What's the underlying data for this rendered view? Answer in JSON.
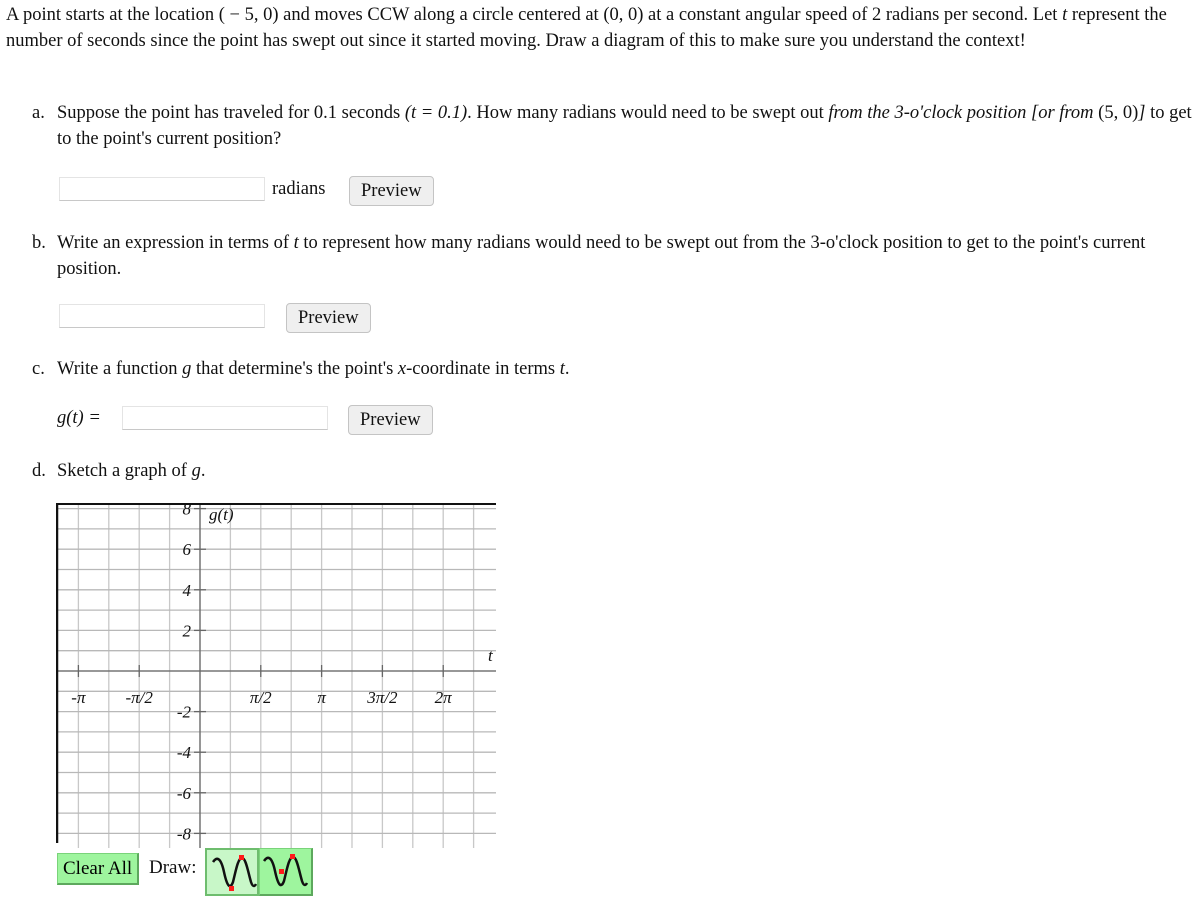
{
  "intro": {
    "p1": "A point starts at the location ",
    "start_point": "( − 5, 0)",
    "p2": " and moves CCW along a circle centered at ",
    "center": "(0, 0)",
    "p3": " at a constant angular speed of 2 radians per second. Let ",
    "var_t": "t",
    "p4": " represent the number of seconds since the point has swept out since it started moving. Draw a diagram of this to make sure you understand the context!"
  },
  "part_a": {
    "label": "a.",
    "text1": "Suppose the point has traveled for 0.1 seconds ",
    "math1": "(t = 0.1)",
    "text2": ". How many radians would need to be swept out ",
    "italic": "from the 3-o'clock position [or from ",
    "math2": "(5, 0)",
    "italic2": "]",
    "text3": " to get to the point's current position?",
    "input_value": "",
    "unit": "radians",
    "preview_label": "Preview"
  },
  "part_b": {
    "label": "b.",
    "text1": "Write an expression in terms of ",
    "var": "t",
    "text2": " to represent how many radians would need to be swept out from the 3-o'clock position to get to the point's current position.",
    "input_value": "",
    "preview_label": "Preview"
  },
  "part_c": {
    "label": "c.",
    "text1": "Write a function ",
    "var_g": "g",
    "text2": " that determine's the point's ",
    "var_x": "x",
    "text3": "-coordinate in terms ",
    "var_t": "t",
    "text4": ".",
    "func_label": "g(t) =",
    "input_value": "",
    "preview_label": "Preview"
  },
  "part_d": {
    "label": "d.",
    "text1": "Sketch a graph of ",
    "var_g": "g",
    "text2": "."
  },
  "chart_data": {
    "type": "line",
    "title": "",
    "xlabel": "t",
    "ylabel": "g(t)",
    "x_ticks": [
      {
        "value": -3.14159,
        "label": "-π"
      },
      {
        "value": -1.5708,
        "label": "-π/2"
      },
      {
        "value": 1.5708,
        "label": "π/2"
      },
      {
        "value": 3.14159,
        "label": "π"
      },
      {
        "value": 4.71239,
        "label": "3π/2"
      },
      {
        "value": 6.28319,
        "label": "2π"
      }
    ],
    "y_ticks": [
      {
        "value": 8,
        "label": "8"
      },
      {
        "value": 6,
        "label": "6"
      },
      {
        "value": 4,
        "label": "4"
      },
      {
        "value": 2,
        "label": "2"
      },
      {
        "value": -2,
        "label": "-2"
      },
      {
        "value": -4,
        "label": "-4"
      },
      {
        "value": -6,
        "label": "-6"
      },
      {
        "value": -8,
        "label": "-8"
      }
    ],
    "x_grid_step_fraction_of_pi": 0.25,
    "y_grid_step": 1,
    "xlim": [
      -4.2,
      7.1
    ],
    "ylim": [
      -8.3,
      8.3
    ],
    "grid": true,
    "series": []
  },
  "graph_tools": {
    "clear_label": "Clear All",
    "draw_label": "Draw:",
    "tools": [
      {
        "name": "sine-tool",
        "selected": true
      },
      {
        "name": "sine-phase-tool",
        "selected": false
      }
    ]
  }
}
